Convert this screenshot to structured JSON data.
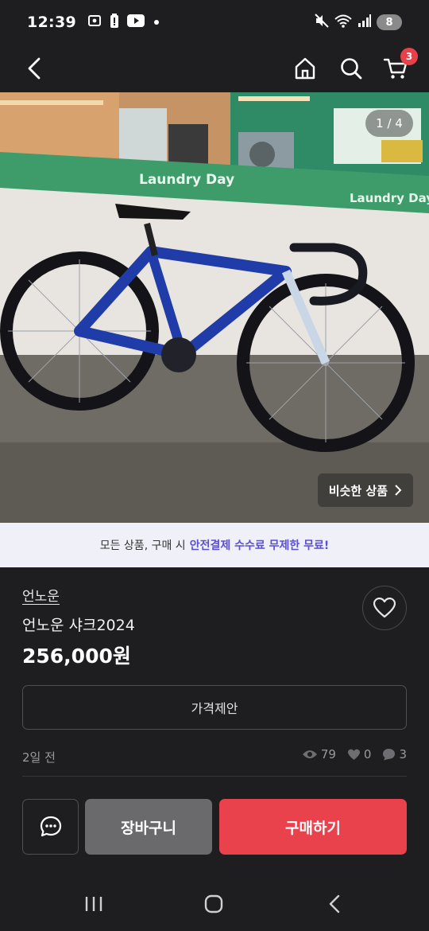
{
  "status_bar": {
    "time": "12:39",
    "battery": "8",
    "icons": [
      "screenshot-icon",
      "battery-alert-icon",
      "youtube-icon",
      "mute-icon",
      "wifi-icon",
      "signal-icon"
    ]
  },
  "header": {
    "cart_count": "3",
    "icons": [
      "back-arrow-icon",
      "home-icon",
      "search-icon",
      "cart-icon"
    ]
  },
  "gallery": {
    "counter": "1 / 4",
    "similar_label": "비슷한 상품",
    "signage_text": "Laundry Day"
  },
  "banner": {
    "prefix": "모든 상품, 구매 시",
    "highlight": "안전결제 수수료 무제한 무료!",
    "highlight_color": "#5b4fd6"
  },
  "product": {
    "seller": "언노운",
    "title": "언노운 샤크2024",
    "price": "256,000원",
    "offer_label": "가격제안",
    "posted": "2일 전",
    "views": "79",
    "likes": "0",
    "chats": "3"
  },
  "actions": {
    "cart_label": "장바구니",
    "buy_label": "구매하기",
    "buy_color": "#e9424c"
  }
}
